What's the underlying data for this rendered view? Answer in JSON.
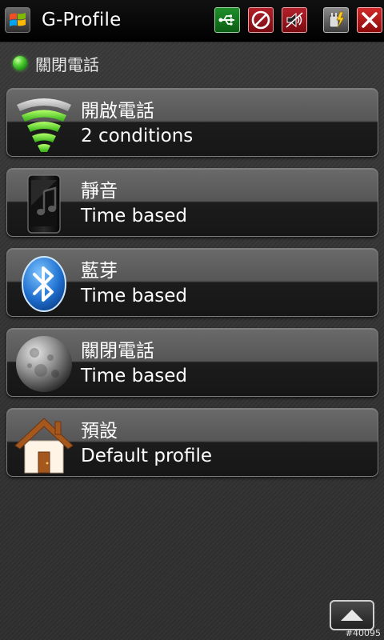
{
  "titlebar": {
    "title": "G-Profile",
    "icons": [
      "windows-start-icon",
      "usb-icon",
      "block-icon",
      "sound-off-icon",
      "charging-icon",
      "close-icon"
    ]
  },
  "status": {
    "label": "關閉電話",
    "indicator_color": "#3fcf2a"
  },
  "profiles": [
    {
      "name": "開啟電話",
      "description": "2 conditions",
      "icon": "signal-icon"
    },
    {
      "name": "靜音",
      "description": "Time based",
      "icon": "phone-silent-icon"
    },
    {
      "name": "藍芽",
      "description": "Time based",
      "icon": "bluetooth-icon"
    },
    {
      "name": "關閉電話",
      "description": "Time based",
      "icon": "moon-icon"
    },
    {
      "name": "預設",
      "description": "Default profile",
      "icon": "home-icon"
    }
  ],
  "footer": {
    "scroll_icon": "arrow-up-icon",
    "watermark": "#40095"
  },
  "colors": {
    "accent_green": "#3fcf2a",
    "titlebar_bg": "#000000",
    "item_border": "#7a7a7a"
  }
}
